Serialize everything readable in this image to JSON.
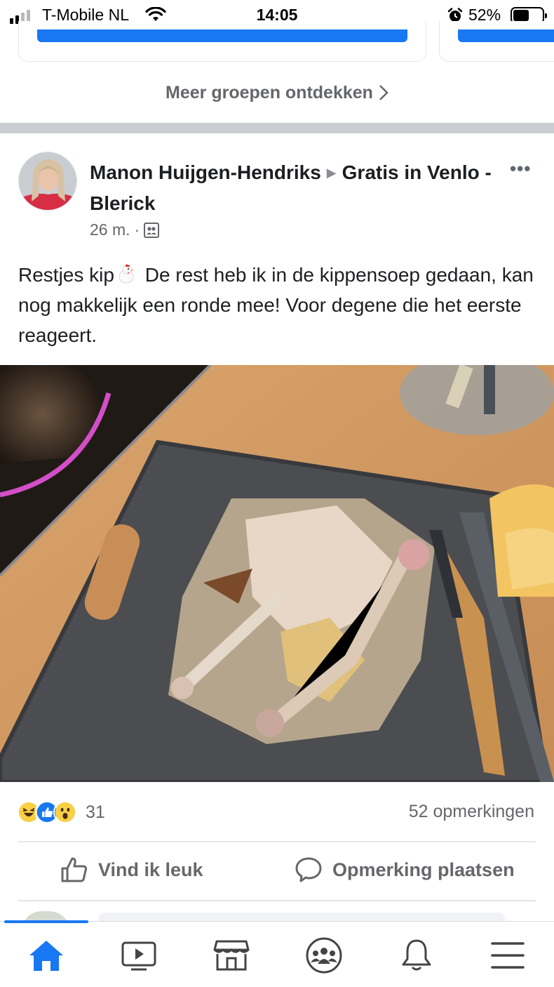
{
  "status_bar": {
    "carrier": "T-Mobile NL",
    "time": "14:05",
    "battery": "52%",
    "icons": [
      "signal-icon",
      "wifi-icon",
      "alarm-icon",
      "battery-icon"
    ]
  },
  "groups": {
    "discover_more": "Meer groepen ontdekken",
    "chevron": "›"
  },
  "post": {
    "author": "Manon Huijgen-Hendriks",
    "target_group": "Gratis in Venlo - Blerick",
    "time": "26 m.",
    "separator": "·",
    "audience_icon": "group-icon",
    "text_before": "Restjes kip",
    "text_after": " De rest heb ik in de kippensoep gedaan, kan nog makkelijk een ronde mee! Voor degene die het eerste reageert.",
    "reactions": {
      "types": [
        "haha",
        "like",
        "wow"
      ],
      "count": "31"
    },
    "comments_count": "52 opmerkingen",
    "actions": {
      "like": "Vind ik leuk",
      "comment": "Opmerking plaatsen"
    }
  },
  "nav": {
    "items": [
      "home",
      "watch",
      "marketplace",
      "groups",
      "notifications",
      "menu"
    ],
    "active": "home"
  },
  "colors": {
    "facebook_blue": "#1877f2",
    "secondary_text": "#65676b",
    "divider": "#e4e6eb"
  }
}
